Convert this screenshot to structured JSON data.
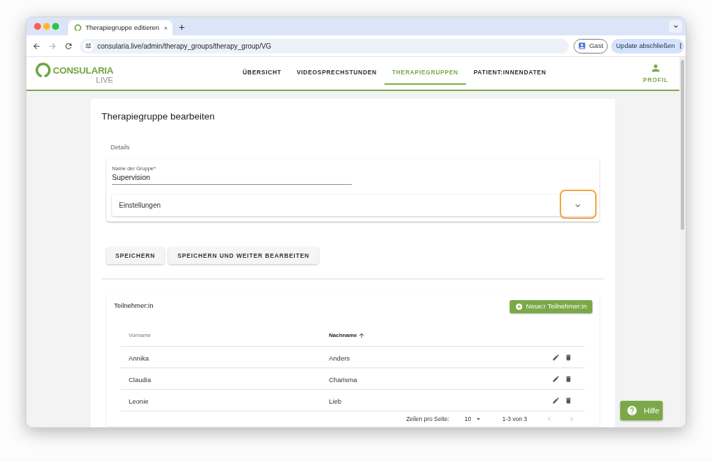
{
  "browser": {
    "tabs": [
      {
        "title": "Therapiegruppe editieren",
        "selected": true
      }
    ],
    "url": "consularia.live/admin/therapy_groups/therapy_group/VG",
    "profile_button": "Gast",
    "update_button": "Update abschließen"
  },
  "app_bar": {
    "logo": {
      "wordmark": "CONSULARIA",
      "subtitle": "LIVE"
    },
    "nav": [
      {
        "label": "ÜBERSICHT",
        "selected": false
      },
      {
        "label": "VIDEOSPRECHSTUNDEN",
        "selected": false
      },
      {
        "label": "THERAPIEGRUPPEN",
        "selected": true
      },
      {
        "label": "PATIENT:INNENDATEN",
        "selected": false
      }
    ],
    "profile": "PROFIL"
  },
  "form": {
    "title": "Therapiegruppe bearbeiten",
    "section": "Details",
    "field": {
      "label": "Name der Gruppe*",
      "value": "Supervision"
    },
    "accordion": {
      "label": "Einstellungen",
      "expanded": false,
      "highlighted": true
    },
    "buttons": [
      "SPEICHERN",
      "SPEICHERN UND WEITER BEARBEITEN"
    ]
  },
  "participants": {
    "title": "Teilnehmer:in",
    "add_button": "Neue:r Teilnehmer:in",
    "columns": [
      {
        "label": "Vorname",
        "sorted": false
      },
      {
        "label": "Nachname",
        "sorted": true
      }
    ],
    "rows": [
      {
        "cells": [
          "Annika",
          "Anders"
        ]
      },
      {
        "cells": [
          "Claudia",
          "Charisma"
        ]
      },
      {
        "cells": [
          "Leonie",
          "Lieb"
        ]
      }
    ],
    "pagination": {
      "rows_per_page_label": "Zeilen pro Seite:",
      "rows_per_page": "10",
      "range": "1-3 von 3",
      "previous_disabled": true,
      "next_disabled": true
    }
  },
  "help_button": "Hilfe"
}
